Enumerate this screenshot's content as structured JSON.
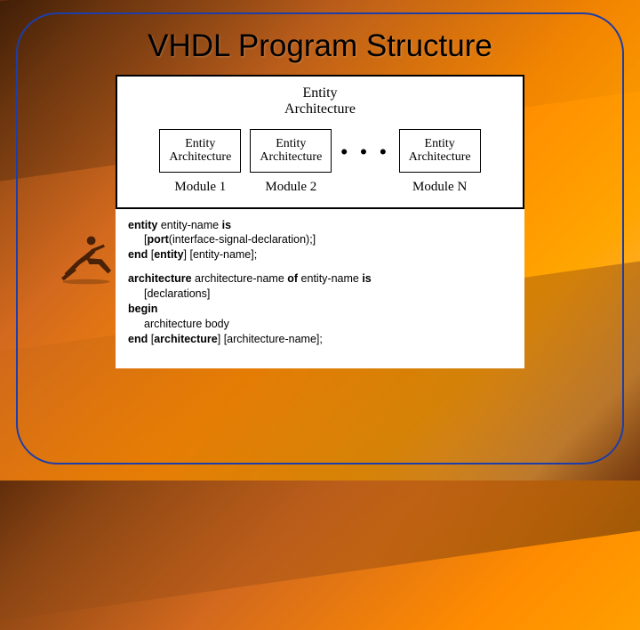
{
  "title": "VHDL Program Structure",
  "diagram": {
    "top": {
      "l1": "Entity",
      "l2": "Architecture"
    },
    "modules": [
      {
        "l1": "Entity",
        "l2": "Architecture",
        "label": "Module 1"
      },
      {
        "l1": "Entity",
        "l2": "Architecture",
        "label": "Module 2"
      },
      {
        "l1": "Entity",
        "l2": "Architecture",
        "label": "Module N"
      }
    ],
    "ellipsis": "• • •"
  },
  "code": {
    "entity_line1a": "entity",
    "entity_line1b": " entity-name ",
    "entity_line1c": "is",
    "entity_line2a": "[",
    "entity_line2b": "port",
    "entity_line2c": "(interface-signal-declaration);]",
    "entity_line3a": "end ",
    "entity_line3b": "[",
    "entity_line3c": "entity",
    "entity_line3d": "] [entity-name];",
    "arch_line1a": "architecture",
    "arch_line1b": " architecture-name ",
    "arch_line1c": "of",
    "arch_line1d": " entity-name ",
    "arch_line1e": "is",
    "arch_line2": "[declarations]",
    "arch_line3": "begin",
    "arch_line4": "architecture body",
    "arch_line5a": "end ",
    "arch_line5b": "[",
    "arch_line5c": "architecture",
    "arch_line5d": "] [architecture-name];"
  }
}
